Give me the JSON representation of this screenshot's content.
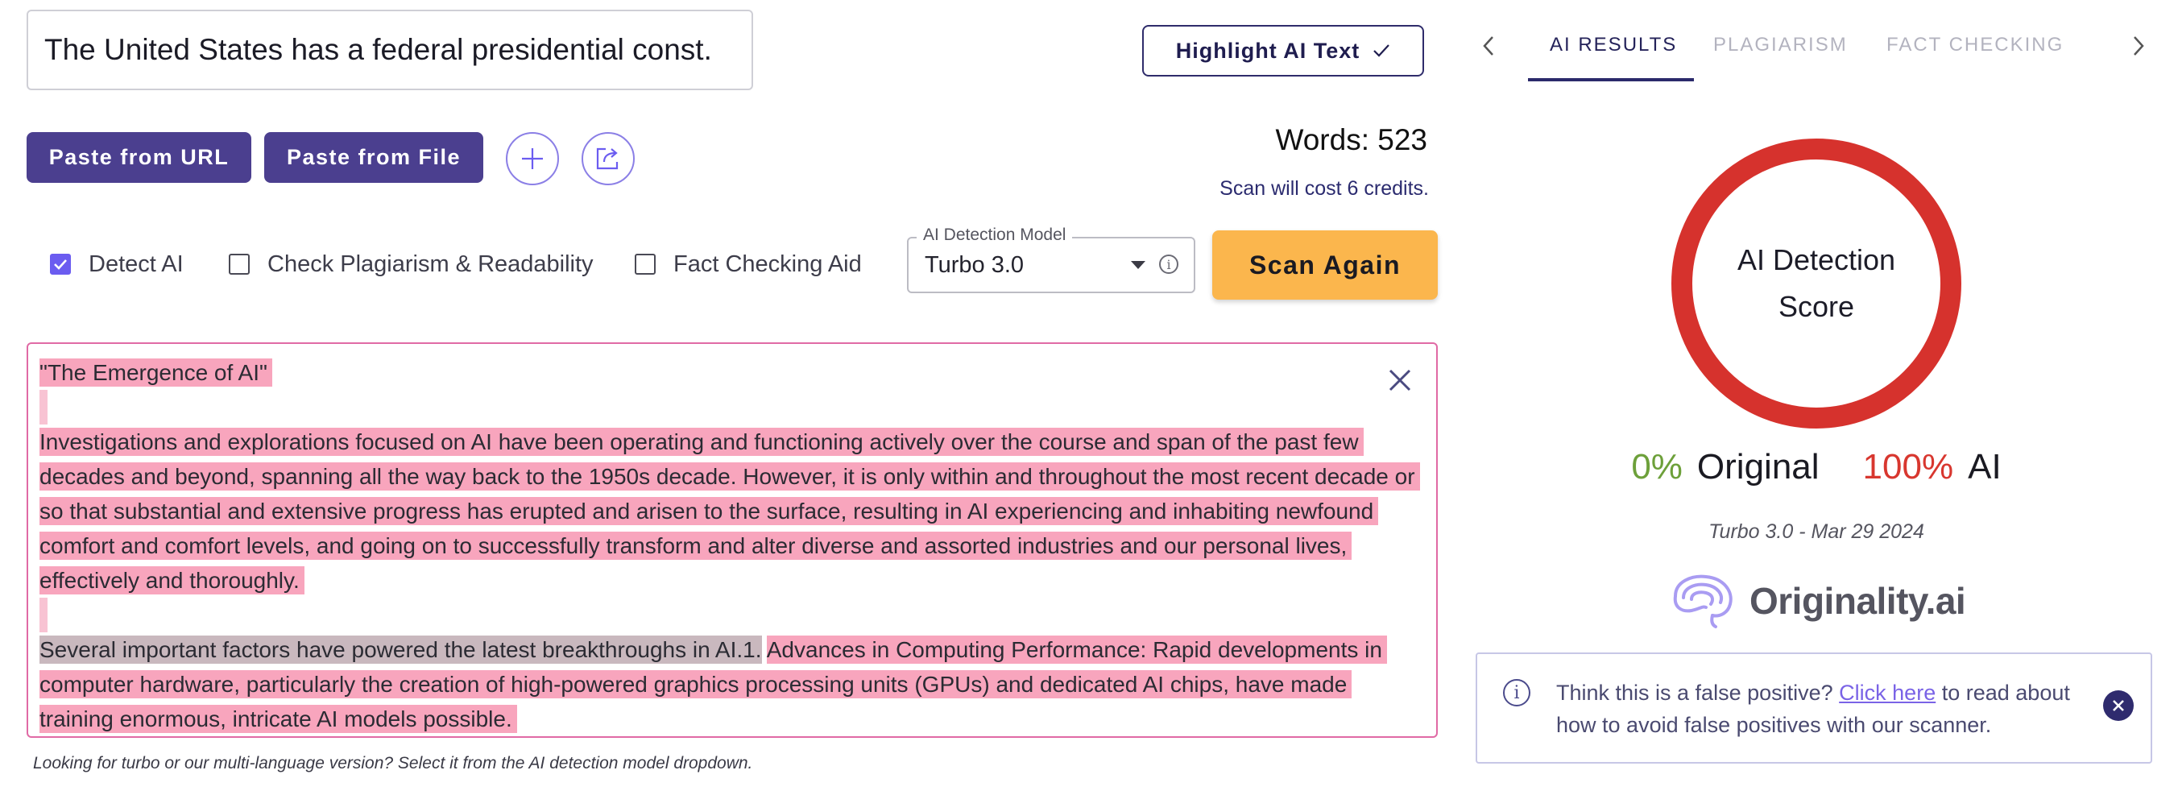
{
  "editor": {
    "title_value": "The United States has a federal presidential const.",
    "highlight_label": "Highlight AI Text",
    "paste_url_label": "Paste from URL",
    "paste_file_label": "Paste from File",
    "words_label": "Words: 523",
    "cost_label": "Scan will cost 6 credits.",
    "options": [
      {
        "label": "Detect AI",
        "checked": true
      },
      {
        "label": "Check Plagiarism & Readability",
        "checked": false
      },
      {
        "label": "Fact Checking Aid",
        "checked": false
      }
    ],
    "model_select": {
      "legend": "AI Detection Model",
      "value": "Turbo 3.0"
    },
    "scan_label": "Scan Again",
    "text": {
      "title_line": "\"The Emergence of AI\"",
      "para1": "Investigations and explorations focused on AI have been operating and functioning actively over the course and span of the past few decades and beyond, spanning all the way back to the 1950s decade. However, it is only within and throughout the most recent decade or so that substantial and extensive progress has erupted and arisen to the surface, resulting in AI experiencing and inhabiting newfound comfort and comfort levels, and going on to successfully transform and alter diverse and assorted industries and our personal lives, effectively and thoroughly.",
      "para2_gray": "Several important factors have powered the latest breakthroughs in AI.1.",
      "para2_pink": "Advances in Computing Performance: Rapid developments in computer hardware, particularly the creation of high-powered graphics processing units (GPUs) and dedicated AI chips, have made training enormous, intricate AI models possible."
    },
    "footnote": "Looking for turbo or our multi-language version? Select it from the AI detection model dropdown."
  },
  "results": {
    "tabs": [
      "AI RESULTS",
      "PLAGIARISM",
      "FACT CHECKING"
    ],
    "active_tab": "AI RESULTS",
    "score_label": "AI Detection Score",
    "original_pct": "0%",
    "original_label": "Original",
    "ai_pct": "100%",
    "ai_label": "AI",
    "model_date": "Turbo 3.0 - Mar 29 2024",
    "brand_name": "Originality.ai",
    "false_positive": {
      "prefix": "Think this is a false positive? ",
      "link": "Click here",
      "suffix": " to read about how to avoid false positives with our scanner."
    }
  },
  "colors": {
    "brand_purple": "#4b3f8f",
    "scan_orange": "#fbb64d",
    "ai_red": "#d6322d",
    "original_green": "#6da03a",
    "highlight_pink": "#f8a5bd"
  }
}
